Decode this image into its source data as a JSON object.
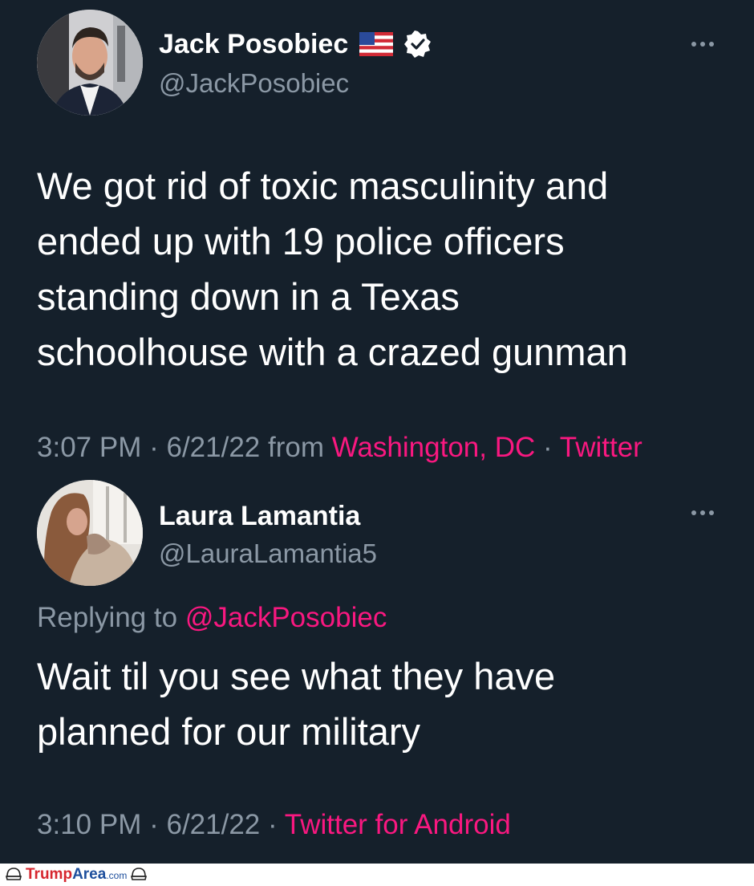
{
  "main_tweet": {
    "display_name": "Jack Posobiec",
    "handle": "@JackPosobiec",
    "text": "We got rid of toxic masculinity and\nended up with 19 police officers\nstanding down in a Texas\nschoolhouse with a crazed gunman",
    "time": "3:07 PM",
    "date": "6/21/22",
    "from_label": "from",
    "location": "Washington, DC",
    "source": "Twitter",
    "badges": [
      "us-flag-icon",
      "verified-badge-icon"
    ]
  },
  "reply_tweet": {
    "display_name": "Laura Lamantia",
    "handle": "@LauraLamantia5",
    "replying_label": "Replying to",
    "replying_to": "@JackPosobiec",
    "text": "Wait til you see what they have\nplanned for our military",
    "time": "3:10 PM",
    "date": "6/21/22",
    "source": "Twitter for Android"
  },
  "watermark": {
    "brand_a": "Trump",
    "brand_b": "Area",
    "brand_c": ".com"
  },
  "colors": {
    "background": "#15202b",
    "text": "#ffffff",
    "secondary": "#8b98a5",
    "accent": "#f91880"
  }
}
